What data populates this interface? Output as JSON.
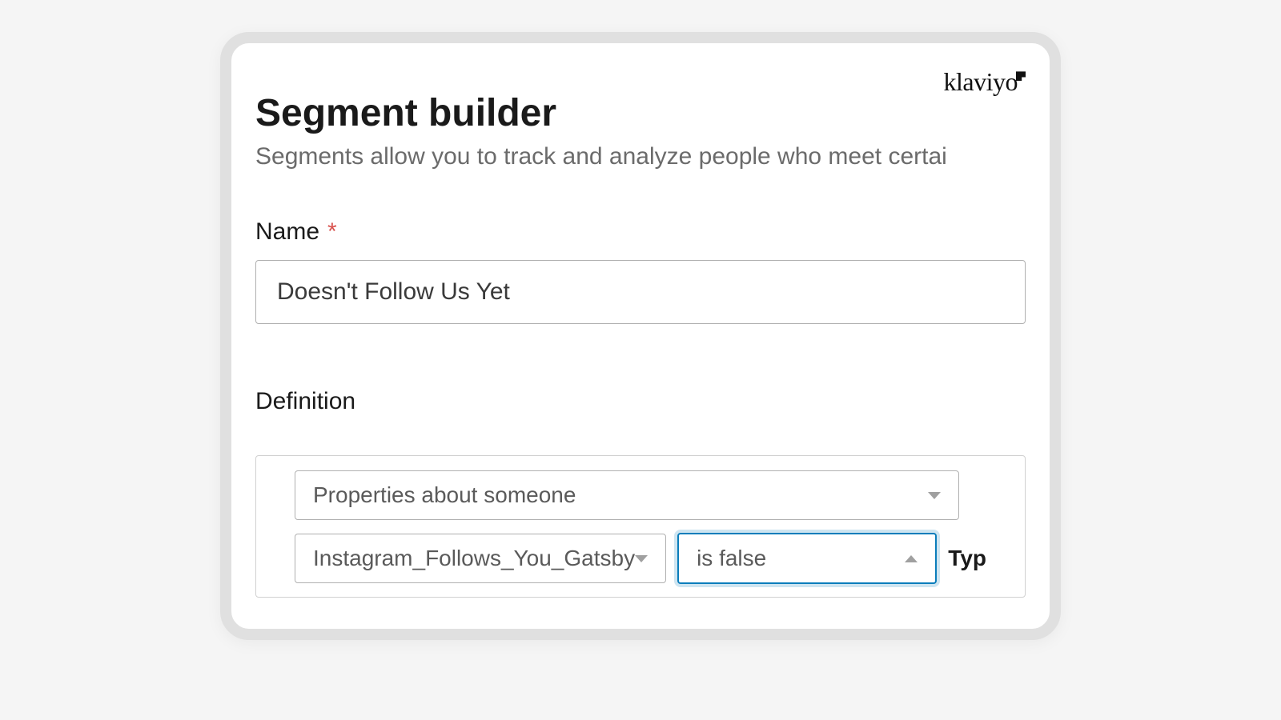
{
  "brand": "klaviyo",
  "header": {
    "title": "Segment builder",
    "subtitle": "Segments allow you to track and analyze people who meet certai"
  },
  "form": {
    "name_label": "Name",
    "required_mark": "*",
    "name_value": "Doesn't Follow Us Yet",
    "definition_label": "Definition"
  },
  "condition": {
    "rule_type": "Properties about someone",
    "property": "Instagram_Follows_You_Gatsby",
    "operator": "is false",
    "type_label_partial": "Typ"
  }
}
